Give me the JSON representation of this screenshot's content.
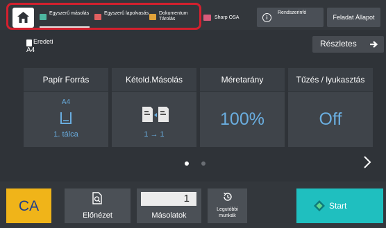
{
  "topbar": {
    "tabs": [
      {
        "label": "Egyszerű másolás",
        "icon": "copy-icon",
        "color": "#4db6a0"
      },
      {
        "label": "Egyszerű lapolvasás",
        "icon": "scan-icon",
        "color": "#e26060"
      },
      {
        "label": "Dokumentum Tárolás",
        "icon": "folder-icon",
        "color": "#e0a23a"
      }
    ],
    "sharp_osa": "Sharp OSA",
    "system_info": "Rendszerinfó",
    "job_status": "Feladat Állapot",
    "highlight_color": "#d4202e"
  },
  "original": {
    "label": "Eredeti",
    "value": "A4"
  },
  "details_button": "Részletes",
  "cards": [
    {
      "title": "Papír Forrás",
      "size": "A4",
      "tray": "1. tálca"
    },
    {
      "title": "Kétold.Másolás",
      "mode": "1 → 1"
    },
    {
      "title": "Méretarány",
      "value": "100%"
    },
    {
      "title": "Tűzés / lyukasztás",
      "value": "Off"
    }
  ],
  "bottom": {
    "ca": "CA",
    "preview": "Előnézet",
    "copies_value": "1",
    "copies_label": "Másolatok",
    "recent": "Legutóbbi munkák",
    "start": "Start"
  },
  "colors": {
    "accent_blue": "#6aaee0",
    "ca_yellow": "#f0b419",
    "start_teal": "#1fbfbf"
  }
}
